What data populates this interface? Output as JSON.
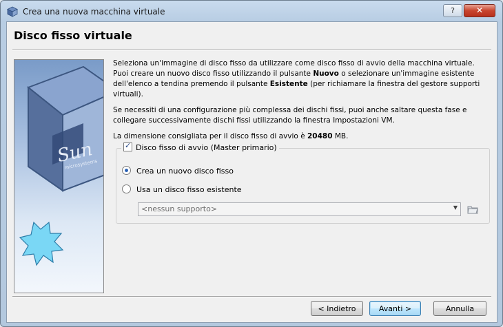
{
  "window": {
    "title": "Crea una nuova macchina virtuale",
    "help_label": "?",
    "close_label": "✕"
  },
  "page": {
    "heading": "Disco fisso virtuale"
  },
  "side_image": {
    "logo_text": "Sun",
    "logo_sub": "microsystems"
  },
  "text": {
    "p1_a": "Seleziona un'immagine di disco fisso da utilizzare come disco fisso di avvio della macchina virtuale. Puoi creare un nuovo disco fisso utilizzando il pulsante ",
    "p1_b": "Nuovo",
    "p1_c": " o selezionare un'immagine esistente dell'elenco a tendina premendo il pulsante ",
    "p1_d": "Esistente",
    "p1_e": " (per richiamare la finestra del gestore supporti virtuali).",
    "p2": "Se necessiti di una configurazione più complessa dei dischi fissi, puoi anche saltare questa fase e collegare successivamente dischi fissi utilizzando la finestra Impostazioni VM.",
    "p3_a": "La dimensione consigliata per il disco fisso di avvio è ",
    "p3_b": "20480",
    "p3_c": " MB."
  },
  "boot_disk": {
    "checkbox_label": "Disco fisso di avvio (Master primario)",
    "checked": true,
    "options": [
      {
        "label": "Crea un nuovo disco fisso",
        "selected": true
      },
      {
        "label": "Usa un disco fisso esistente",
        "selected": false
      }
    ],
    "combo_value": "<nessun supporto>"
  },
  "buttons": {
    "back": "< Indietro",
    "next": "Avanti >",
    "cancel": "Annulla"
  }
}
